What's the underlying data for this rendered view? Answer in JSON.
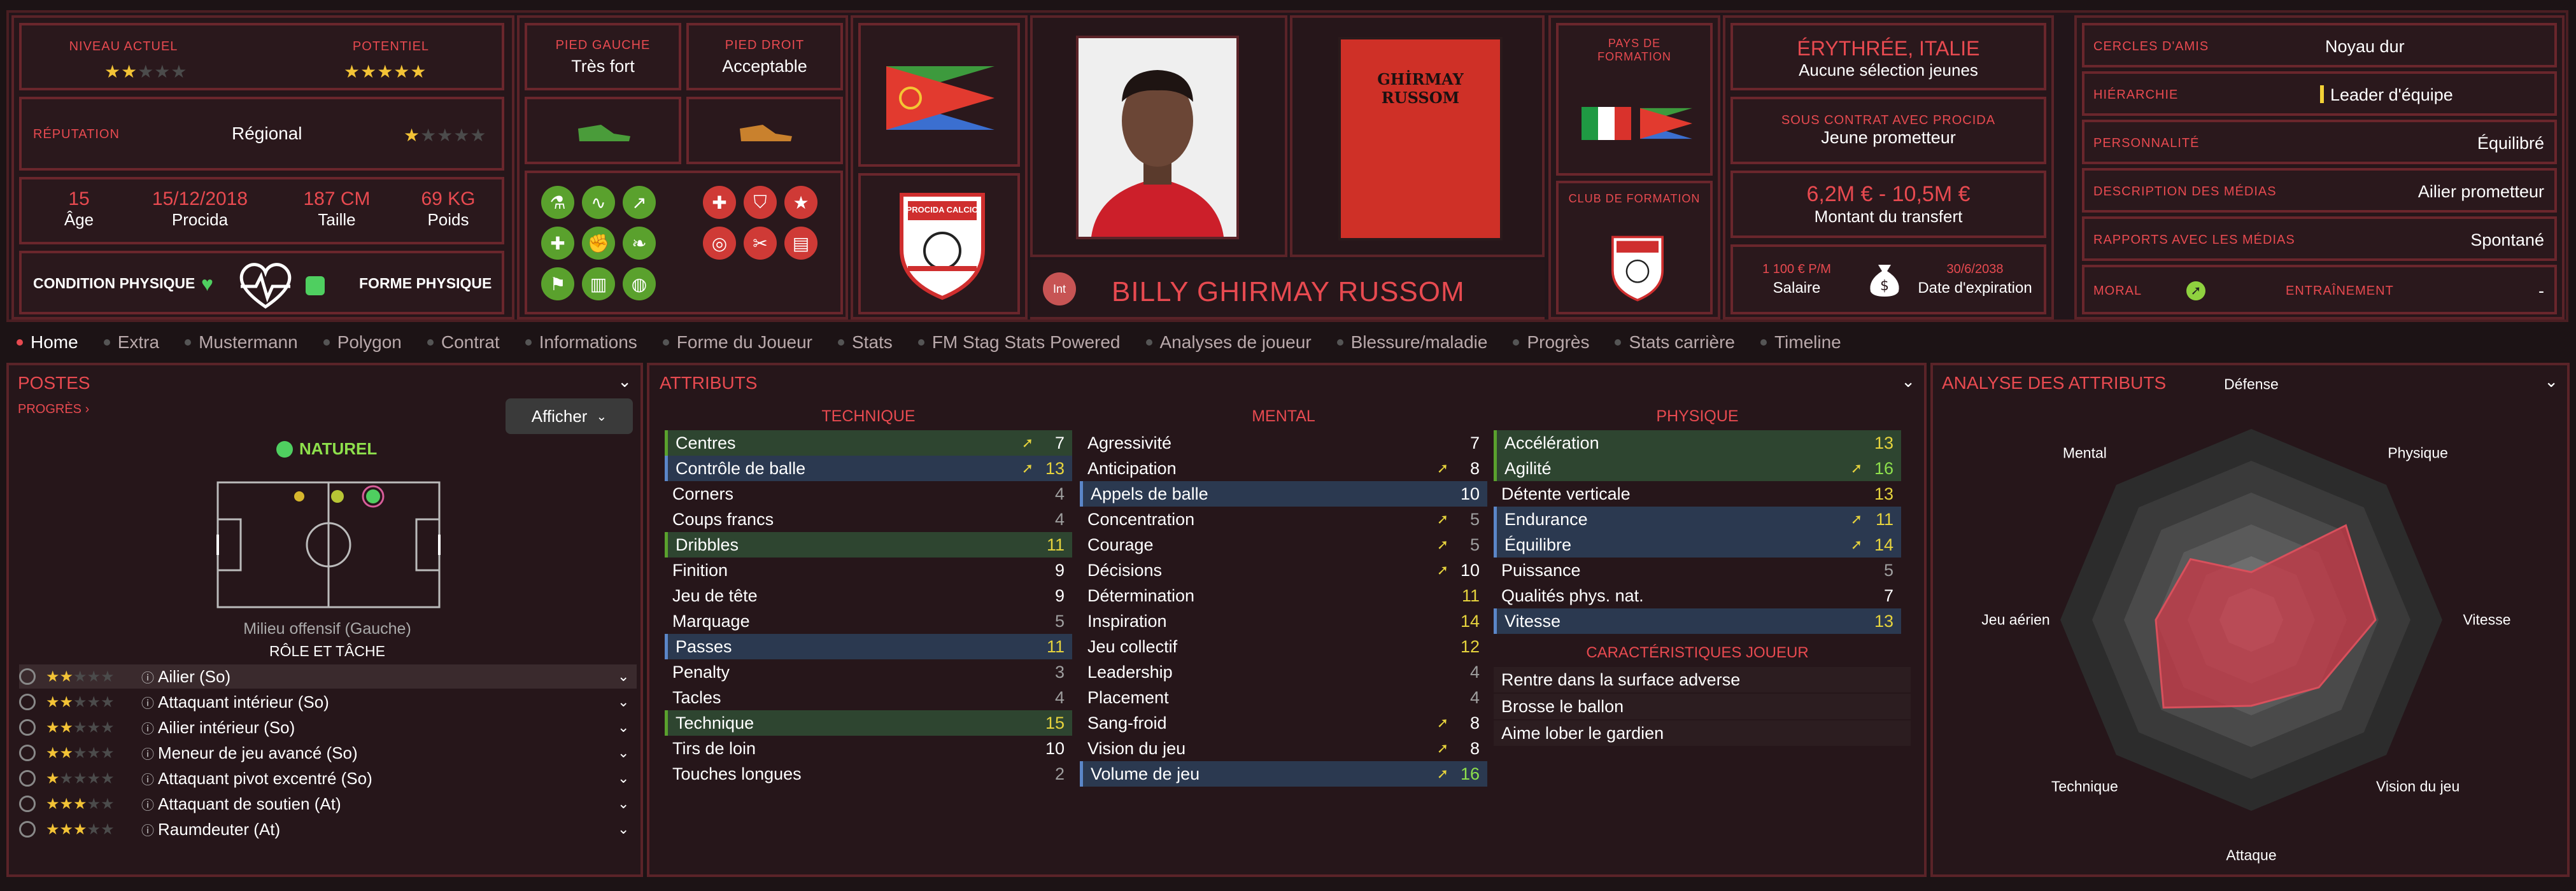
{
  "header": {
    "current_level_label": "NIVEAU ACTUEL",
    "current_level_stars": "★★",
    "current_level_stars_off": "★★★",
    "potential_label": "POTENTIEL",
    "potential_stars": "★★★★★",
    "reputation_label": "RÉPUTATION",
    "reputation_value": "Régional",
    "reputation_stars": "★",
    "reputation_stars_off": "★★★★",
    "age_value": "15",
    "age_label": "Âge",
    "date_value": "15/12/2018",
    "date_label": "Procida",
    "height_value": "187 CM",
    "height_label": "Taille",
    "weight_value": "69 KG",
    "weight_label": "Poids",
    "condition_label": "CONDITION PHYSIQUE",
    "form_label": "FORME PHYSIQUE",
    "left_foot_label": "PIED GAUCHE",
    "left_foot_value": "Très fort",
    "right_foot_label": "PIED DROIT",
    "right_foot_value": "Acceptable",
    "club_crest_text": "PROCIDA CALCIO",
    "player_badge": "Int",
    "player_name": "BILLY GHIRMAY RUSSOM",
    "shirt_name": "GHİRMAY RUSSOM",
    "formation_country_label": "PAYS DE FORMATION",
    "formation_club_label": "CLUB DE FORMATION",
    "nationality": "ÉRYTHRÉE, ITALIE",
    "nationality_sub": "Aucune sélection jeunes",
    "contract_label": "SOUS CONTRAT AVEC PROCIDA",
    "contract_value": "Jeune prometteur",
    "transfer_value": "6,2M € - 10,5M €",
    "transfer_label": "Montant du transfert",
    "salary_value": "1 100 € P/M",
    "salary_label": "Salaire",
    "expiry_value": "30/6/2038",
    "expiry_label": "Date d'expiration",
    "friends_label": "CERCLES D'AMIS",
    "friends_value": "Noyau dur",
    "hierarchy_label": "HIÉRARCHIE",
    "hierarchy_value": "Leader d'équipe",
    "personality_label": "PERSONNALITÉ",
    "personality_value": "Équilibré",
    "media_desc_label": "DESCRIPTION DES MÉDIAS",
    "media_desc_value": "Ailier prometteur",
    "media_rel_label": "RAPPORTS AVEC LES MÉDIAS",
    "media_rel_value": "Spontané",
    "morale_label": "MORAL",
    "training_label": "ENTRAÎNEMENT",
    "training_value": "-"
  },
  "tabs": [
    "Home",
    "Extra",
    "Mustermann",
    "Polygon",
    "Contrat",
    "Informations",
    "Forme du Joueur",
    "Stats",
    "FM Stag Stats Powered",
    "Analyses de joueur",
    "Blessure/maladie",
    "Progrès",
    "Stats carrière",
    "Timeline"
  ],
  "positions": {
    "title": "POSTES",
    "progress_link": "PROGRÈS",
    "show_button": "Afficher",
    "natural_label": "NATUREL",
    "position_name": "Milieu offensif (Gauche)",
    "role_title": "RÔLE ET TÂCHE",
    "roles": [
      {
        "name": "Ailier (So)",
        "stars": "★★",
        "off": "★★★"
      },
      {
        "name": "Attaquant intérieur (So)",
        "stars": "★★",
        "off": "★★★"
      },
      {
        "name": "Ailier intérieur (So)",
        "stars": "★★",
        "off": "★★★"
      },
      {
        "name": "Meneur de jeu avancé (So)",
        "stars": "★★",
        "off": "★★★"
      },
      {
        "name": "Attaquant pivot excentré (So)",
        "stars": "★",
        "off": "★★★★"
      },
      {
        "name": "Attaquant de soutien (At)",
        "stars": "★★★",
        "off": "★★"
      },
      {
        "name": "Raumdeuter (At)",
        "stars": "★★★",
        "off": "★★"
      }
    ]
  },
  "attributes": {
    "title": "ATTRIBUTS",
    "technical_title": "TECHNIQUE",
    "mental_title": "MENTAL",
    "physical_title": "PHYSIQUE",
    "technical": [
      {
        "name": "Centres",
        "value": "7",
        "arrow": true,
        "hl": "g",
        "c": "white"
      },
      {
        "name": "Contrôle de balle",
        "value": "13",
        "arrow": true,
        "hl": "b",
        "c": "yellow"
      },
      {
        "name": "Corners",
        "value": "4",
        "arrow": false,
        "hl": "",
        "c": "grey"
      },
      {
        "name": "Coups francs",
        "value": "4",
        "arrow": false,
        "hl": "",
        "c": "grey"
      },
      {
        "name": "Dribbles",
        "value": "11",
        "arrow": false,
        "hl": "g",
        "c": "yellow"
      },
      {
        "name": "Finition",
        "value": "9",
        "arrow": false,
        "hl": "",
        "c": "white"
      },
      {
        "name": "Jeu de tête",
        "value": "9",
        "arrow": false,
        "hl": "",
        "c": "white"
      },
      {
        "name": "Marquage",
        "value": "5",
        "arrow": false,
        "hl": "",
        "c": "grey"
      },
      {
        "name": "Passes",
        "value": "11",
        "arrow": false,
        "hl": "b",
        "c": "yellow"
      },
      {
        "name": "Penalty",
        "value": "3",
        "arrow": false,
        "hl": "",
        "c": "grey"
      },
      {
        "name": "Tacles",
        "value": "4",
        "arrow": false,
        "hl": "",
        "c": "grey"
      },
      {
        "name": "Technique",
        "value": "15",
        "arrow": false,
        "hl": "g",
        "c": "yellow"
      },
      {
        "name": "Tirs de loin",
        "value": "10",
        "arrow": false,
        "hl": "",
        "c": "white"
      },
      {
        "name": "Touches longues",
        "value": "2",
        "arrow": false,
        "hl": "",
        "c": "grey"
      }
    ],
    "mental": [
      {
        "name": "Agressivité",
        "value": "7",
        "arrow": false,
        "hl": "",
        "c": "white"
      },
      {
        "name": "Anticipation",
        "value": "8",
        "arrow": true,
        "hl": "",
        "c": "white"
      },
      {
        "name": "Appels de balle",
        "value": "10",
        "arrow": false,
        "hl": "b",
        "c": "white"
      },
      {
        "name": "Concentration",
        "value": "5",
        "arrow": true,
        "hl": "",
        "c": "grey"
      },
      {
        "name": "Courage",
        "value": "5",
        "arrow": true,
        "hl": "",
        "c": "grey"
      },
      {
        "name": "Décisions",
        "value": "10",
        "arrow": true,
        "hl": "",
        "c": "white"
      },
      {
        "name": "Détermination",
        "value": "11",
        "arrow": false,
        "hl": "",
        "c": "yellow"
      },
      {
        "name": "Inspiration",
        "value": "14",
        "arrow": false,
        "hl": "",
        "c": "yellow"
      },
      {
        "name": "Jeu collectif",
        "value": "12",
        "arrow": false,
        "hl": "",
        "c": "yellow"
      },
      {
        "name": "Leadership",
        "value": "4",
        "arrow": false,
        "hl": "",
        "c": "grey"
      },
      {
        "name": "Placement",
        "value": "4",
        "arrow": false,
        "hl": "",
        "c": "grey"
      },
      {
        "name": "Sang-froid",
        "value": "8",
        "arrow": true,
        "hl": "",
        "c": "white"
      },
      {
        "name": "Vision du jeu",
        "value": "8",
        "arrow": true,
        "hl": "",
        "c": "white"
      },
      {
        "name": "Volume de jeu",
        "value": "16",
        "arrow": true,
        "hl": "b",
        "c": "green"
      }
    ],
    "physical": [
      {
        "name": "Accélération",
        "value": "13",
        "arrow": false,
        "hl": "g",
        "c": "yellow"
      },
      {
        "name": "Agilité",
        "value": "16",
        "arrow": true,
        "hl": "g",
        "c": "green"
      },
      {
        "name": "Détente verticale",
        "value": "13",
        "arrow": false,
        "hl": "",
        "c": "yellow"
      },
      {
        "name": "Endurance",
        "value": "11",
        "arrow": true,
        "hl": "b",
        "c": "yellow"
      },
      {
        "name": "Équilibre",
        "value": "14",
        "arrow": true,
        "hl": "b",
        "c": "yellow"
      },
      {
        "name": "Puissance",
        "value": "5",
        "arrow": false,
        "hl": "",
        "c": "grey"
      },
      {
        "name": "Qualités phys. nat.",
        "value": "7",
        "arrow": false,
        "hl": "",
        "c": "white"
      },
      {
        "name": "Vitesse",
        "value": "13",
        "arrow": false,
        "hl": "b",
        "c": "yellow"
      }
    ],
    "traits_title": "CARACTÉRISTIQUES JOUEUR",
    "traits": [
      "Rentre dans la surface adverse",
      "Brosse le ballon",
      "Aime lober le gardien"
    ]
  },
  "analysis": {
    "title": "ANALYSE DES ATTRIBUTS"
  },
  "chart_data": {
    "type": "radar",
    "title": "ANALYSE DES ATTRIBUTS",
    "categories": [
      "Défense",
      "Physique",
      "Vitesse",
      "Vision du jeu",
      "Attaque",
      "Technique",
      "Jeu aérien",
      "Mental"
    ],
    "range": [
      0,
      20
    ],
    "values": [
      5,
      14,
      13,
      10,
      9,
      13,
      10,
      9
    ]
  },
  "colors": {
    "accent": "#e84a50",
    "green": "#5aa12d",
    "yellow": "#e6d33d",
    "blue_hl": "#2b3950",
    "green_hl": "#2e4530"
  }
}
